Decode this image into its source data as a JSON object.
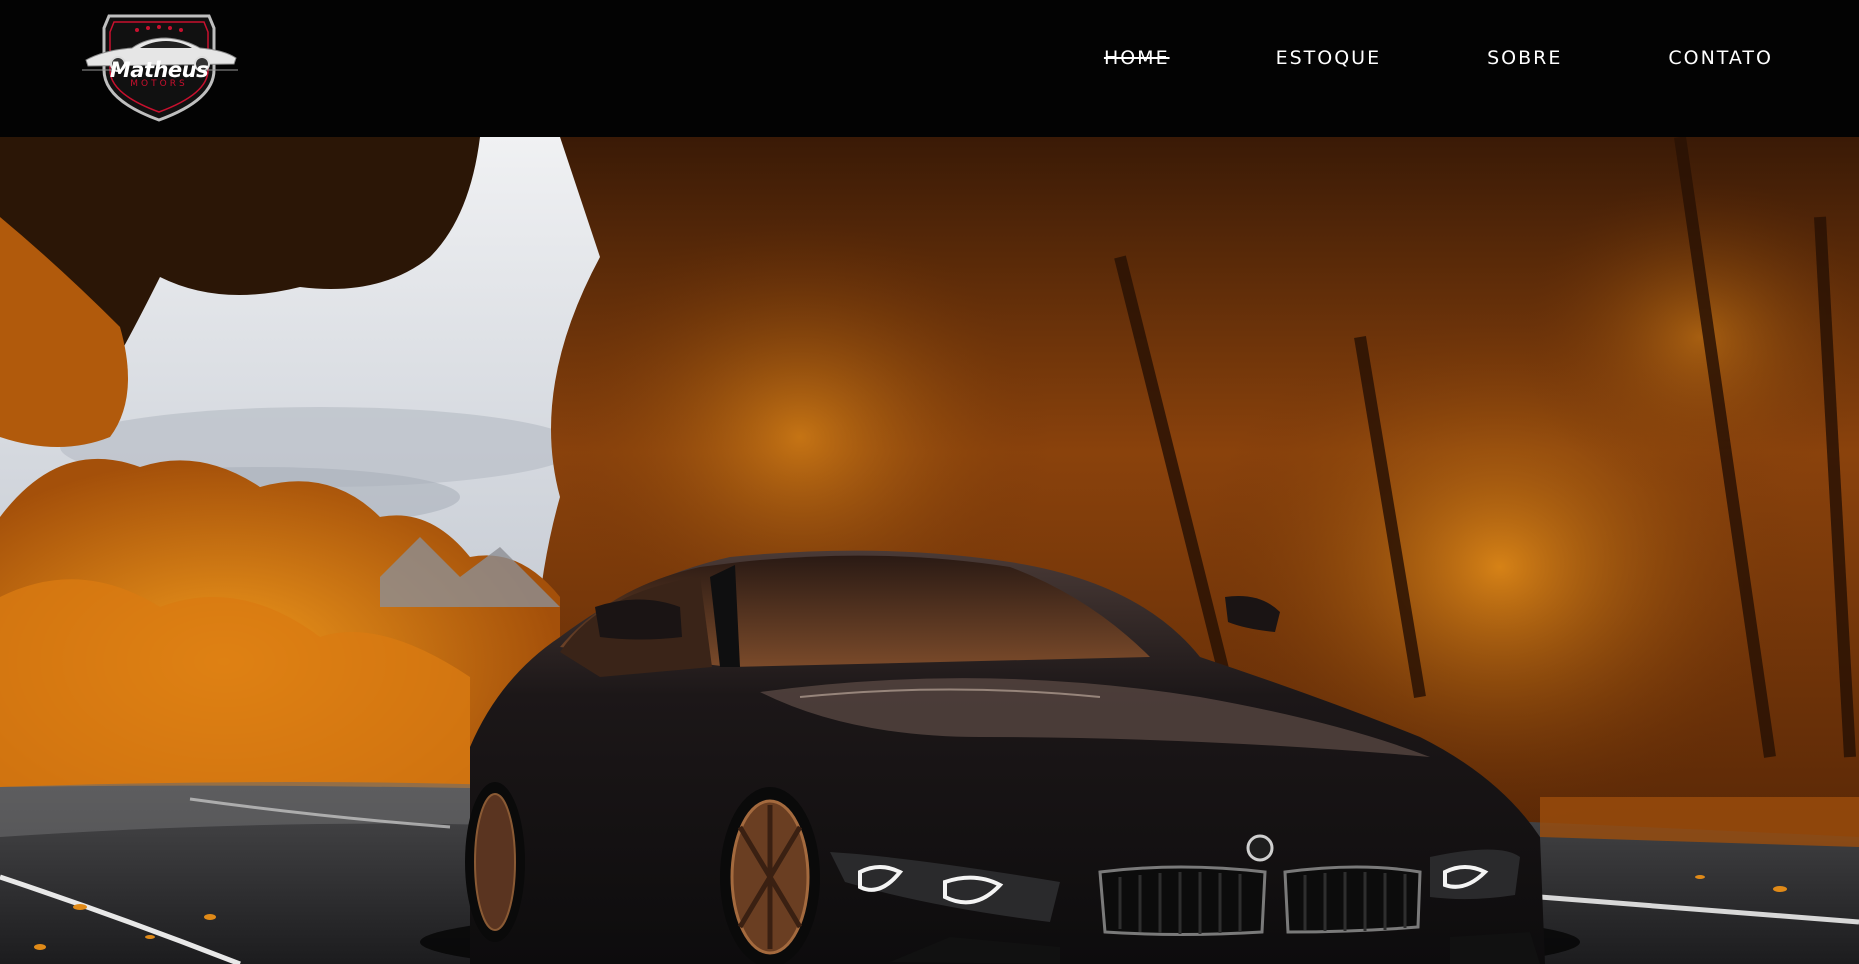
{
  "brand": {
    "logo_title": "Matheus",
    "logo_subtitle": "MOTORS",
    "logo_icon": "car-shield-logo",
    "accent": "#c8102e"
  },
  "nav": {
    "items": [
      {
        "label": "HOME",
        "active": true
      },
      {
        "label": "ESTOQUE",
        "active": false
      },
      {
        "label": "SOBRE",
        "active": false
      },
      {
        "label": "CONTATO",
        "active": false
      }
    ]
  },
  "hero": {
    "image": "hero-car-autumn-road",
    "palette": {
      "sky": "#dfe3e8",
      "foliage": "#c96a0c",
      "foliage_dark": "#5a2806",
      "road": "#2b2b2d",
      "car": "#1a1718"
    }
  },
  "colors": {
    "header_bg": "#030303",
    "nav_text": "#ffffff"
  }
}
